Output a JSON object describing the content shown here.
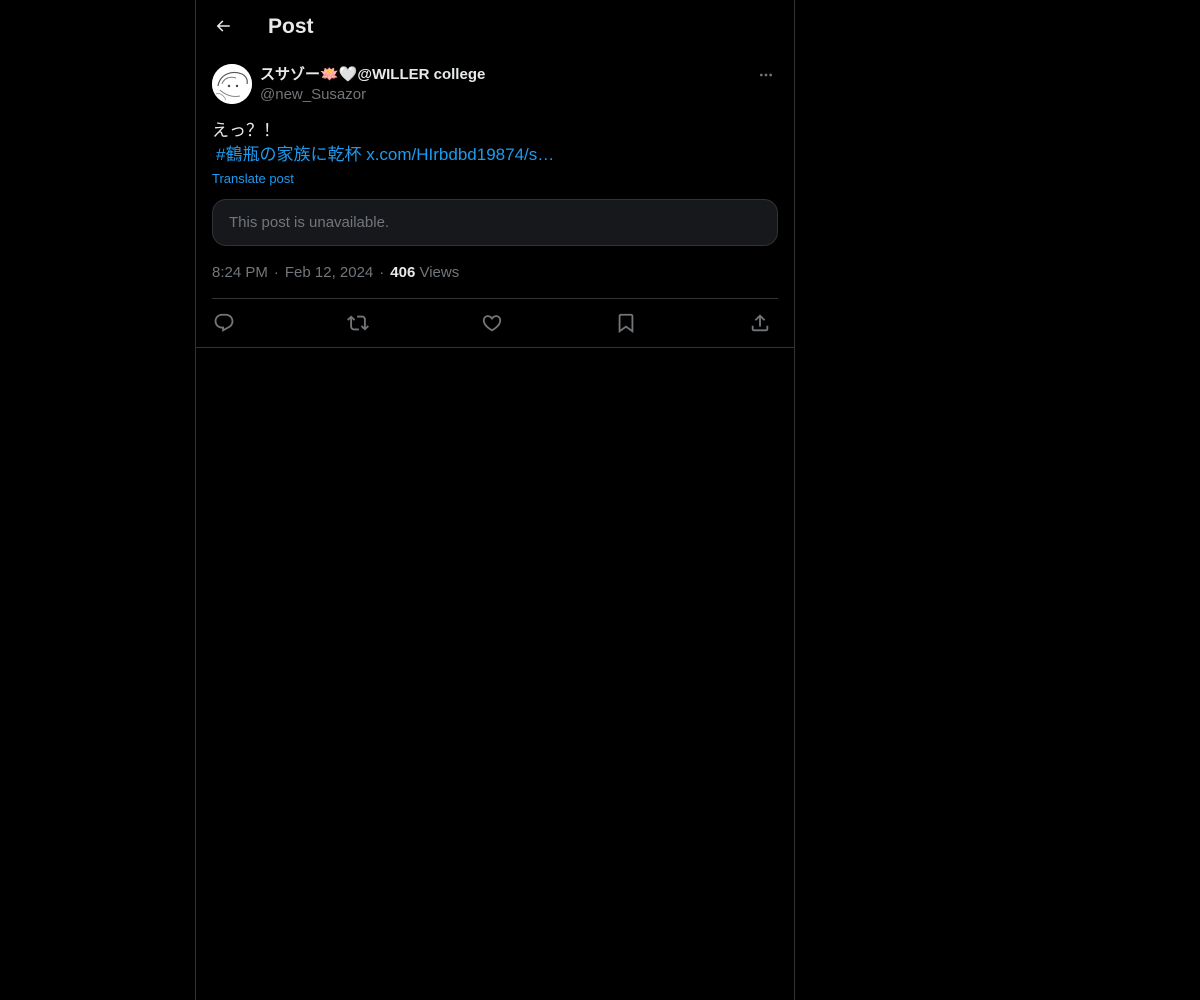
{
  "header": {
    "title": "Post",
    "back_icon": "arrow-left-icon"
  },
  "author": {
    "display_name": "スサゾー🪷🤍@WILLER college",
    "handle": "@new_Susazor",
    "avatar_bg": "#ffffff"
  },
  "post": {
    "text": "えっ？！",
    "hashtag": "#鶴瓶の家族に乾杯",
    "link": "x.com/HIrbdbd19874/s…",
    "translate_label": "Translate post"
  },
  "quote": {
    "unavailable_text": "This post is unavailable."
  },
  "meta": {
    "time": "8:24 PM",
    "date": "Feb 12, 2024",
    "views_count": "406",
    "views_label": "Views",
    "separator": "·"
  },
  "actions": [
    {
      "name": "reply",
      "icon": "reply-icon"
    },
    {
      "name": "repost",
      "icon": "repost-icon"
    },
    {
      "name": "like",
      "icon": "heart-icon"
    },
    {
      "name": "bookmark",
      "icon": "bookmark-icon"
    },
    {
      "name": "share",
      "icon": "share-icon"
    }
  ],
  "colors": {
    "background": "#000000",
    "text_primary": "#e7e9ea",
    "text_secondary": "#71767b",
    "accent": "#1d9bf0",
    "border": "#2f3336"
  }
}
